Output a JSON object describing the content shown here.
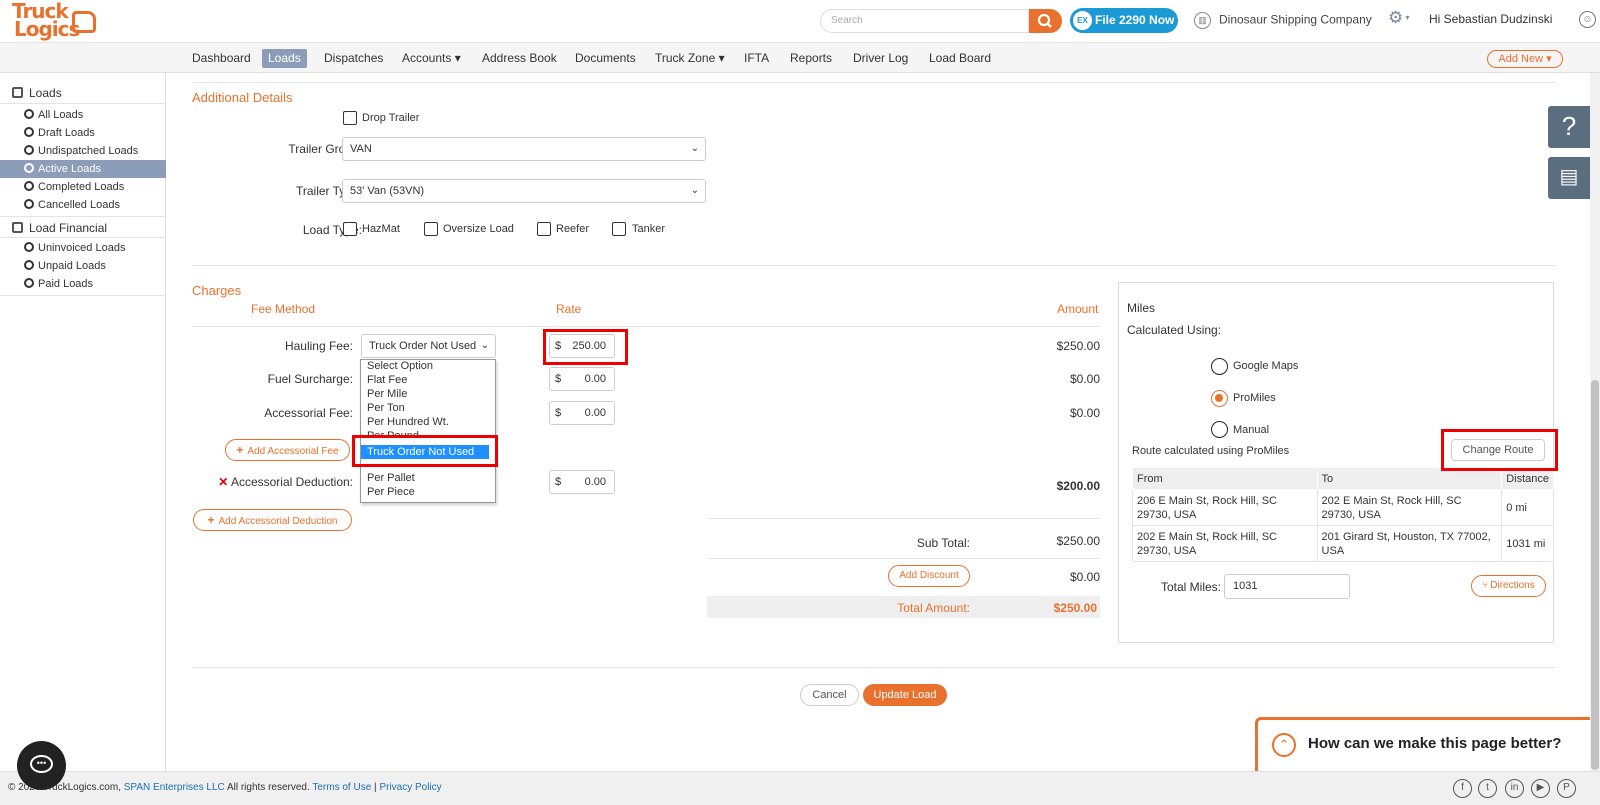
{
  "brand": {
    "logo_line1": "Truck",
    "logo_line2": "Logics"
  },
  "header": {
    "search_placeholder": "Search",
    "file_button": "File 2290 Now",
    "file_icon": "EX",
    "company": "Dinosaur Shipping Company",
    "greeting": "Hi Sebastian Dudzinski"
  },
  "nav": {
    "items": [
      "Dashboard",
      "Loads",
      "Dispatches",
      "Accounts ▾",
      "Address Book",
      "Documents",
      "Truck Zone ▾",
      "IFTA",
      "Reports",
      "Driver Log",
      "Load Board"
    ],
    "active": "Loads",
    "add_new": "Add New ▾"
  },
  "sidebar": {
    "loads_head": "Loads",
    "loads_items": [
      "All Loads",
      "Draft Loads",
      "Undispatched Loads",
      "Active Loads",
      "Completed Loads",
      "Cancelled Loads"
    ],
    "financial_head": "Load Financial",
    "financial_items": [
      "Uninvoiced Loads",
      "Unpaid Loads",
      "Paid Loads"
    ]
  },
  "details": {
    "title": "Additional Details",
    "drop_trailer": "Drop Trailer",
    "trailer_group_label": "Trailer Group:",
    "trailer_group_value": "VAN",
    "trailer_type_label": "Trailer Type:",
    "trailer_type_value": "53' Van (53VN)",
    "load_type_label": "Load Type:",
    "load_types": [
      "HazMat",
      "Oversize Load",
      "Reefer",
      "Tanker"
    ]
  },
  "charges": {
    "title": "Charges",
    "col_fee_method": "Fee Method",
    "col_rate": "Rate",
    "col_amount": "Amount",
    "hauling_label": "Hauling Fee:",
    "hauling_method": "Truck Order Not Used",
    "hauling_rate": "250.00",
    "hauling_amount": "$250.00",
    "fuel_label": "Fuel Surcharge:",
    "fuel_rate": "0.00",
    "fuel_amount": "$0.00",
    "accessorial_label": "Accessorial Fee:",
    "accessorial_rate": "0.00",
    "accessorial_amount": "$0.00",
    "add_accessorial_fee": "Add Accessorial Fee",
    "deduction_label": "Accessorial Deduction:",
    "deduction_rate": "0.00",
    "deduction_amount": "$200.00",
    "add_accessorial_deduction": "Add Accessorial Deduction",
    "currency": "$",
    "subtotal_label": "Sub Total:",
    "subtotal": "$250.00",
    "add_discount": "Add Discount",
    "discount": "$0.00",
    "total_label": "Total Amount:",
    "total": "$250.00"
  },
  "dropdown": {
    "options": [
      "Select Option",
      "Flat Fee",
      "Per Mile",
      "Per Ton",
      "Per Hundred Wt.",
      "Per Pound",
      "Per Pallet",
      "Per Piece"
    ],
    "selected": "Truck Order Not Used"
  },
  "miles": {
    "title": "Miles",
    "calc_label": "Calculated Using:",
    "options": [
      "Google Maps",
      "ProMiles",
      "Manual"
    ],
    "selected": "ProMiles",
    "route_note": "Route calculated using ProMiles",
    "change_route": "Change Route",
    "table_headers": [
      "From",
      "To",
      "Distance"
    ],
    "routes": [
      {
        "from": "206 E Main St, Rock Hill, SC 29730, USA",
        "to": "202 E Main St, Rock Hill, SC 29730, USA",
        "distance": "0 mi"
      },
      {
        "from": "202 E Main St, Rock Hill, SC 29730, USA",
        "to": "201 Girard St, Houston, TX 77002, USA",
        "distance": "1031 mi"
      }
    ],
    "total_label": "Total Miles:",
    "total_value": "1031",
    "directions": "Directions"
  },
  "actions": {
    "cancel": "Cancel",
    "update": "Update Load"
  },
  "feedback": {
    "text": "How can we make this page better?"
  },
  "footer": {
    "copyright": "© 2023 TruckLogics.com, ",
    "company_link": "SPAN Enterprises LLC",
    "rights": " All rights reserved. ",
    "terms": "Terms of Use",
    "privacy": "Privacy Policy"
  },
  "colors": {
    "accent": "#e8712d",
    "nav_active": "#8b9db8",
    "highlight": "#e00000"
  }
}
